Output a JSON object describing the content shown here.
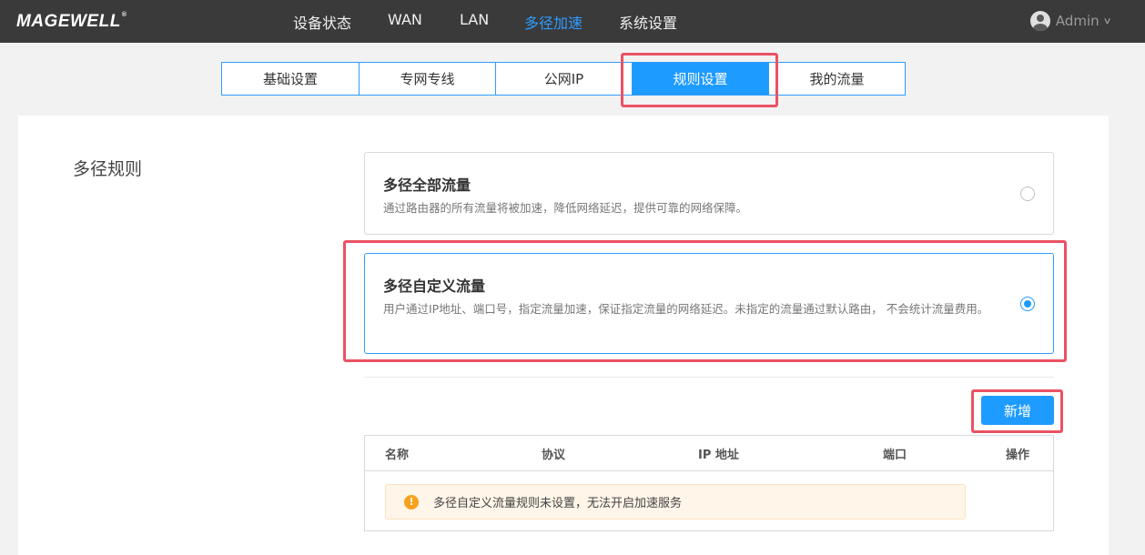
{
  "header": {
    "logo_text": "MAGEWELL",
    "logo_mark": "®",
    "nav": [
      {
        "label": "设备状态",
        "active": false
      },
      {
        "label": "WAN",
        "active": false
      },
      {
        "label": "LAN",
        "active": false
      },
      {
        "label": "多径加速",
        "active": true
      },
      {
        "label": "系统设置",
        "active": false
      }
    ],
    "user_name": "Admin",
    "active_color": "#2f9cff"
  },
  "tabs": [
    {
      "label": "基础设置",
      "active": false
    },
    {
      "label": "专网专线",
      "active": false
    },
    {
      "label": "公网IP",
      "active": false
    },
    {
      "label": "规则设置",
      "active": true
    },
    {
      "label": "我的流量",
      "active": false
    }
  ],
  "section": {
    "title": "多径规则",
    "options": [
      {
        "title": "多径全部流量",
        "desc": "通过路由器的所有流量将被加速，降低网络延迟，提供可靠的网络保障。",
        "selected": false
      },
      {
        "title": "多径自定义流量",
        "desc": "用户通过IP地址、端口号，指定流量加速，保证指定流量的网络延迟。未指定的流量通过默认路由， 不会统计流量费用。",
        "selected": true
      }
    ],
    "add_button": "新增"
  },
  "table": {
    "columns": [
      "名称",
      "协议",
      "IP 地址",
      "端口",
      "操作"
    ],
    "empty_notice": "多径自定义流量规则未设置，无法开启加速服务",
    "notice_icon": "warning-icon",
    "notice_color": "#f7a11e"
  },
  "highlight_color": "#ea5264"
}
